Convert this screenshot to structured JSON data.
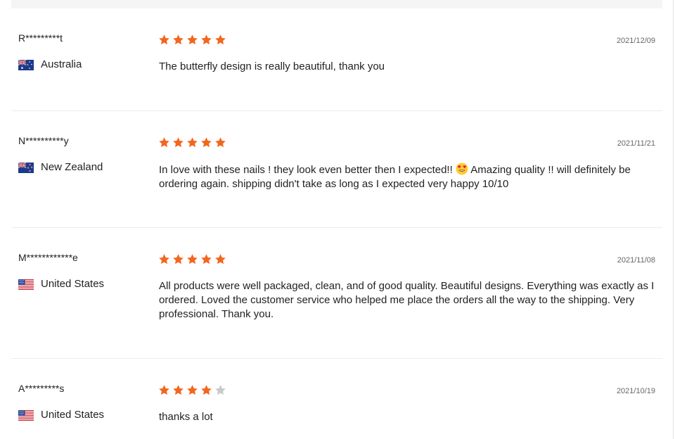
{
  "colors": {
    "star_filled": "#f2661e",
    "star_empty": "#c9c9c9",
    "top_bar": "#f5f5f5",
    "divider": "#ececec"
  },
  "reviews": [
    {
      "author": "R*********t",
      "country": "Australia",
      "flag_icon": "australia-flag-icon",
      "rating": 5,
      "date": "2021/12/09",
      "text": "The butterfly design is really beautiful, thank you"
    },
    {
      "author": "N**********y",
      "country": "New Zealand",
      "flag_icon": "new-zealand-flag-icon",
      "rating": 5,
      "date": "2021/11/21",
      "text_before_emoji": "In love with these nails ! they look even better then I expected!! ",
      "emoji_icon": "heart-eyes-emoji-icon",
      "text_after_emoji": " Amazing quality !! will definitely be ordering again. shipping didn't take as long as I expected very happy 10/10"
    },
    {
      "author": "M************e",
      "country": "United States",
      "flag_icon": "us-flag-icon",
      "rating": 5,
      "date": "2021/11/08",
      "text": "All products were well packaged, clean, and of good quality. Beautiful designs. Everything was exactly as I ordered. Loved the customer service who helped me place the orders all the way to the shipping. Very professional. Thank you."
    },
    {
      "author": "A*********s",
      "country": "United States",
      "flag_icon": "us-flag-icon",
      "rating": 4,
      "date": "2021/10/19",
      "text": "thanks a lot"
    }
  ]
}
